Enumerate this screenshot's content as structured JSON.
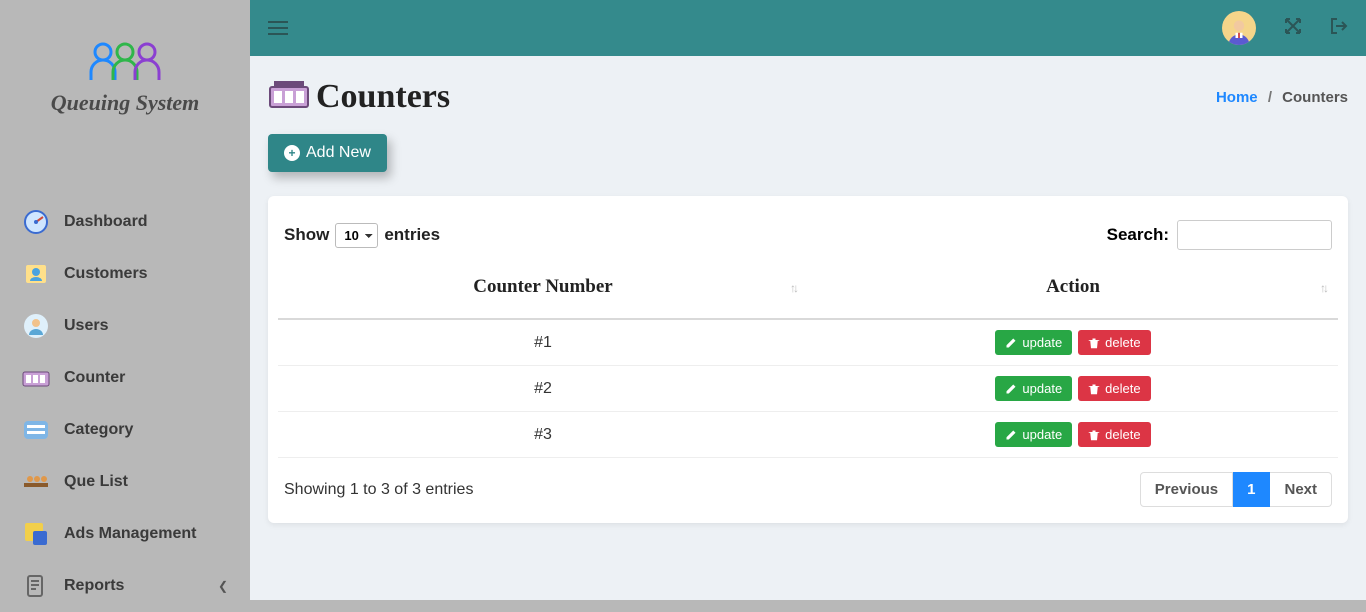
{
  "brand": {
    "title": "Queuing System"
  },
  "sidebar": {
    "items": [
      {
        "label": "Dashboard",
        "icon": "dashboard"
      },
      {
        "label": "Customers",
        "icon": "customers"
      },
      {
        "label": "Users",
        "icon": "users"
      },
      {
        "label": "Counter",
        "icon": "counter"
      },
      {
        "label": "Category",
        "icon": "category"
      },
      {
        "label": "Que List",
        "icon": "quelist"
      },
      {
        "label": "Ads Management",
        "icon": "ads"
      },
      {
        "label": "Reports",
        "icon": "reports",
        "has_children": true
      }
    ]
  },
  "breadcrumb": {
    "home": "Home",
    "current": "Counters",
    "sep": "/"
  },
  "page": {
    "title": "Counters"
  },
  "toolbar": {
    "add_label": "Add New"
  },
  "table": {
    "show_label": "Show",
    "entries_label": "entries",
    "show_value": "10",
    "search_label": "Search:",
    "headers": {
      "counter": "Counter Number",
      "action": "Action"
    },
    "rows": [
      {
        "counter": "#1"
      },
      {
        "counter": "#2"
      },
      {
        "counter": "#3"
      }
    ],
    "action_labels": {
      "update": "update",
      "delete": "delete"
    },
    "info": "Showing 1 to 3 of 3 entries",
    "pager": {
      "prev": "Previous",
      "next": "Next",
      "pages": [
        "1"
      ],
      "active": "1"
    }
  }
}
